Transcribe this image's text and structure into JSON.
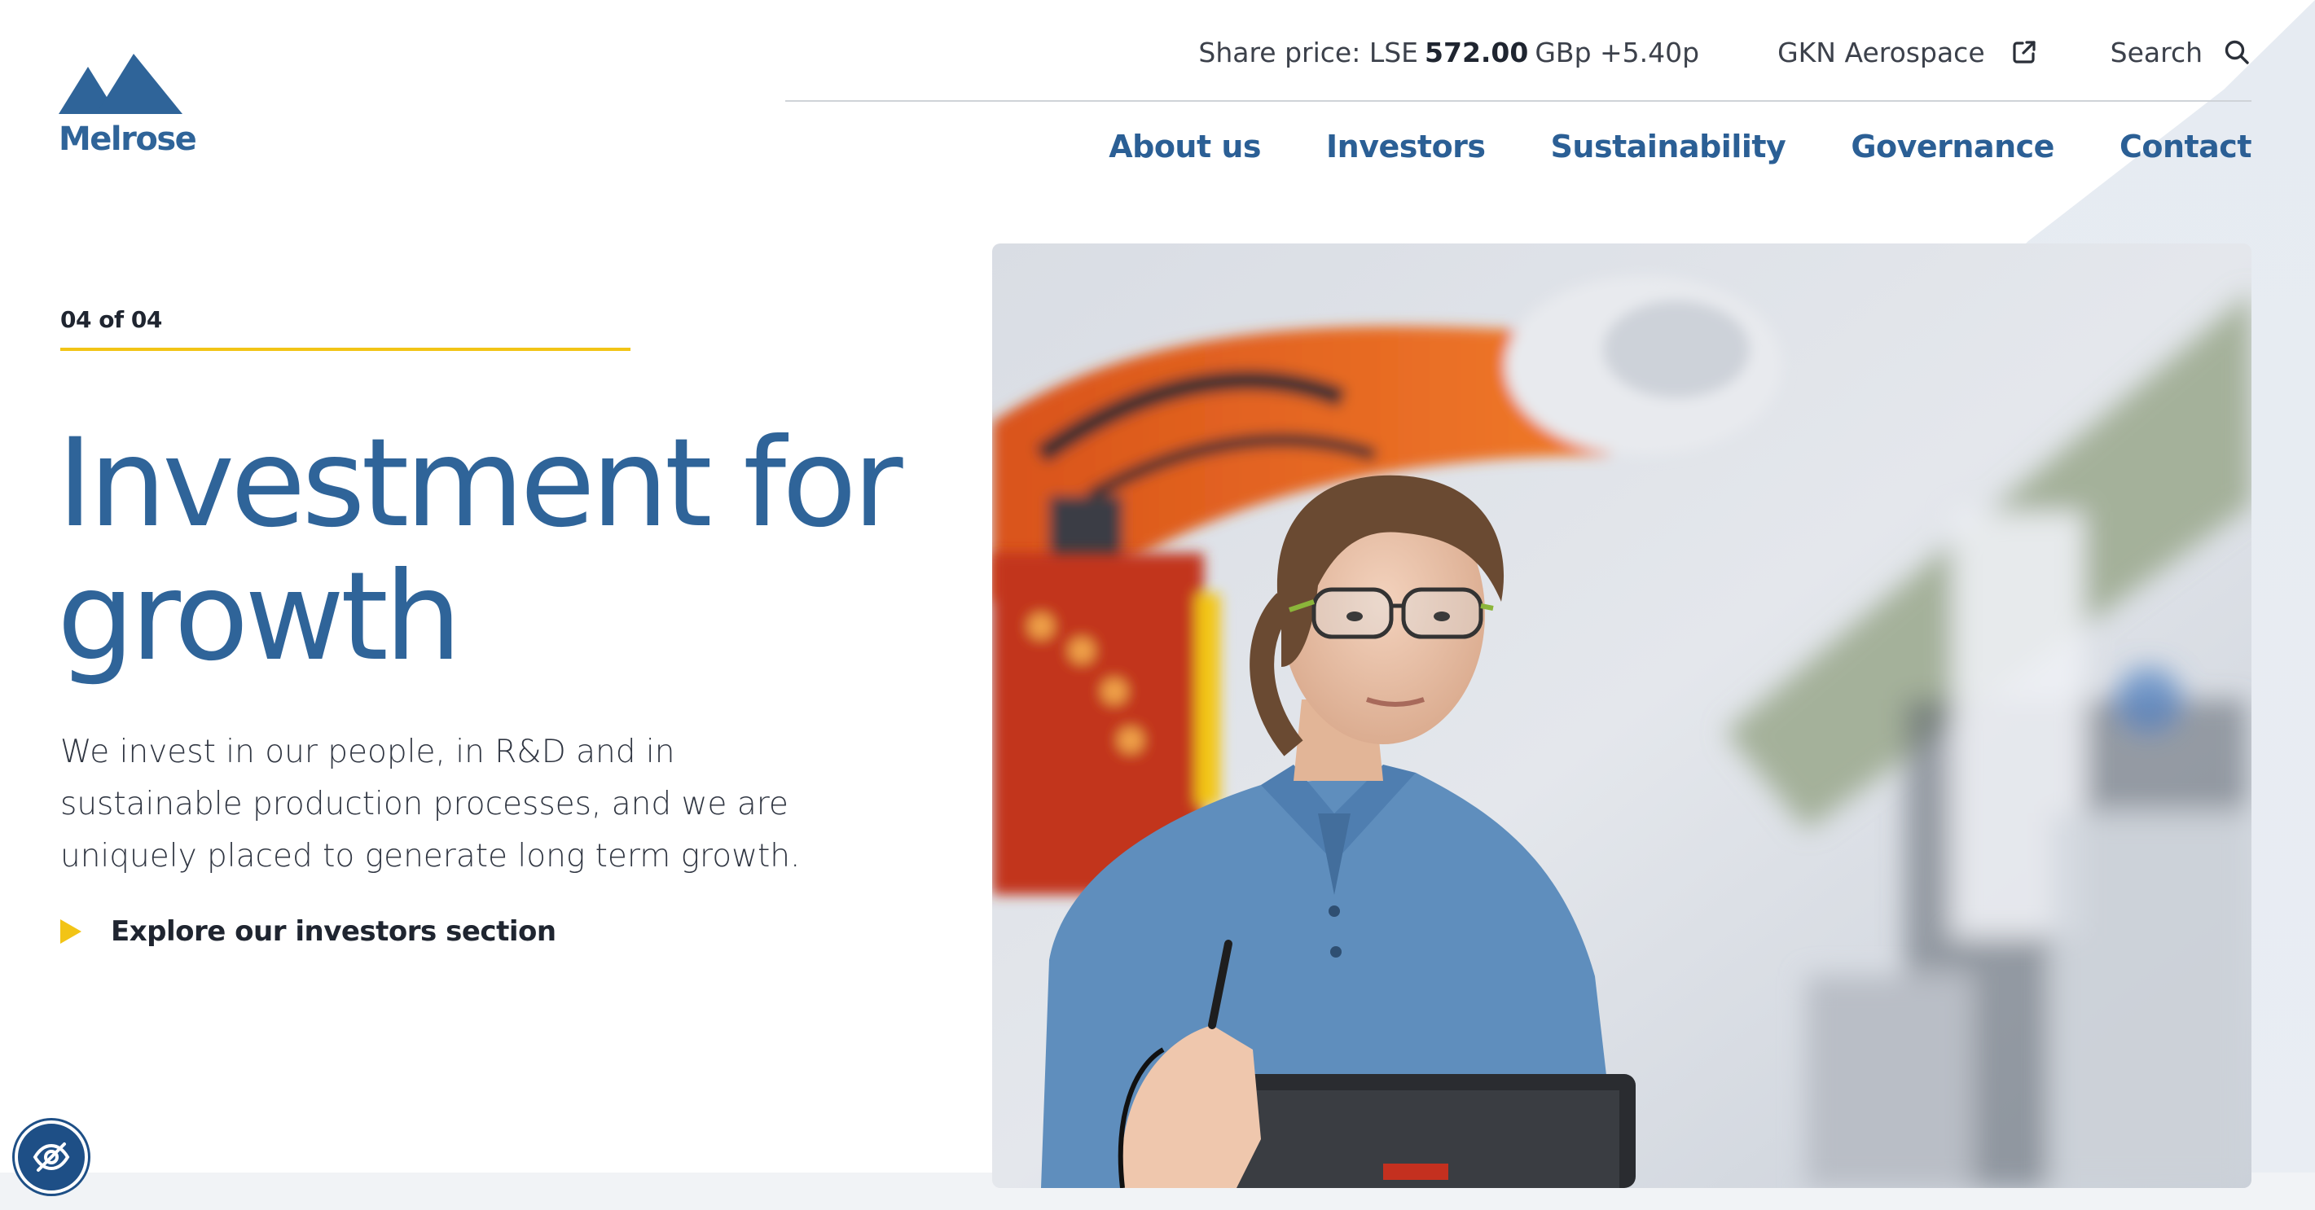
{
  "brand": {
    "logo_text": "Melrose",
    "color_primary": "#2f6499",
    "color_accent": "#f2c416"
  },
  "utility": {
    "share_price_label": "Share price: LSE",
    "share_price_value": "572.00",
    "share_price_unit_change": "GBp +5.40p",
    "gkn_label": "GKN Aerospace",
    "gkn_icon": "external-link-icon",
    "search_label": "Search",
    "search_icon": "search-icon"
  },
  "nav": {
    "items": [
      {
        "label": "About us"
      },
      {
        "label": "Investors"
      },
      {
        "label": "Sustainability"
      },
      {
        "label": "Governance"
      },
      {
        "label": "Contact"
      }
    ]
  },
  "hero": {
    "counter": "04 of 04",
    "progress": 1.0,
    "title_line1": "Investment for",
    "title_line2": "growth",
    "body": "We invest in our people, in R&D and in sustainable production processes, and we are uniquely placed to generate long term growth.",
    "cta_label": "Explore our investors section",
    "cta_icon": "play-triangle-icon",
    "image_alt": "Engineer wearing safety glasses holding a tablet next to an orange industrial robot arm"
  },
  "accessibility": {
    "icon": "eye-slash-icon"
  }
}
